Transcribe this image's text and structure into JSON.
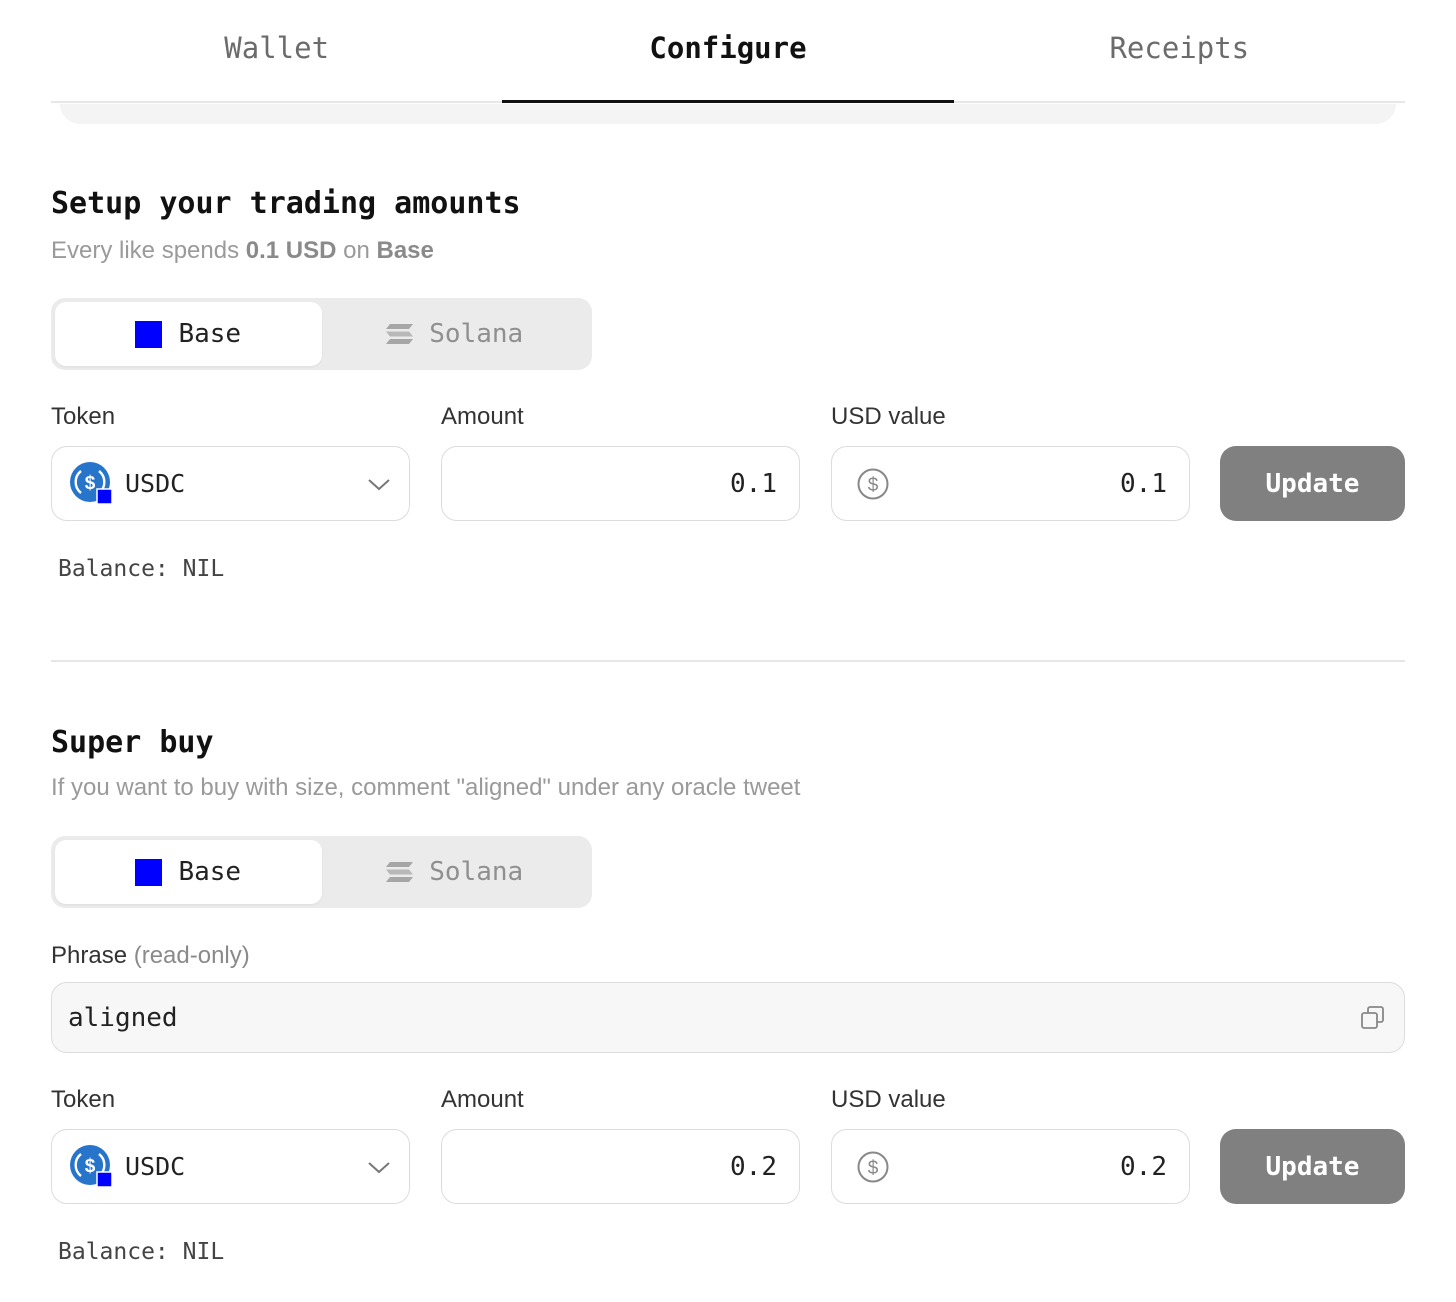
{
  "tabs": [
    {
      "label": "Wallet",
      "active": false
    },
    {
      "label": "Configure",
      "active": true
    },
    {
      "label": "Receipts",
      "active": false
    }
  ],
  "trading": {
    "title": "Setup your trading amounts",
    "sub_prefix": "Every like spends ",
    "sub_amount": "0.1 USD",
    "sub_mid": " on ",
    "sub_chain": "Base",
    "chains": [
      {
        "label": "Base",
        "icon": "base-square-icon",
        "active": true
      },
      {
        "label": "Solana",
        "icon": "solana-icon",
        "active": false
      }
    ],
    "token_label": "Token",
    "amount_label": "Amount",
    "usd_label": "USD value",
    "token": "USDC",
    "amount": "0.1",
    "usd_value": "0.1",
    "update_label": "Update",
    "balance": "Balance: NIL"
  },
  "superbuy": {
    "title": "Super buy",
    "subtitle": "If you want to buy with size, comment \"aligned\" under any oracle tweet",
    "chains": [
      {
        "label": "Base",
        "icon": "base-square-icon",
        "active": true
      },
      {
        "label": "Solana",
        "icon": "solana-icon",
        "active": false
      }
    ],
    "phrase_label": "Phrase",
    "phrase_note": "(read-only)",
    "phrase": "aligned",
    "token_label": "Token",
    "amount_label": "Amount",
    "usd_label": "USD value",
    "token": "USDC",
    "amount": "0.2",
    "usd_value": "0.2",
    "update_label": "Update",
    "balance": "Balance: NIL"
  },
  "colors": {
    "base_blue": "#0000ff",
    "usdc_blue": "#2775ca",
    "button_gray": "#808080"
  }
}
